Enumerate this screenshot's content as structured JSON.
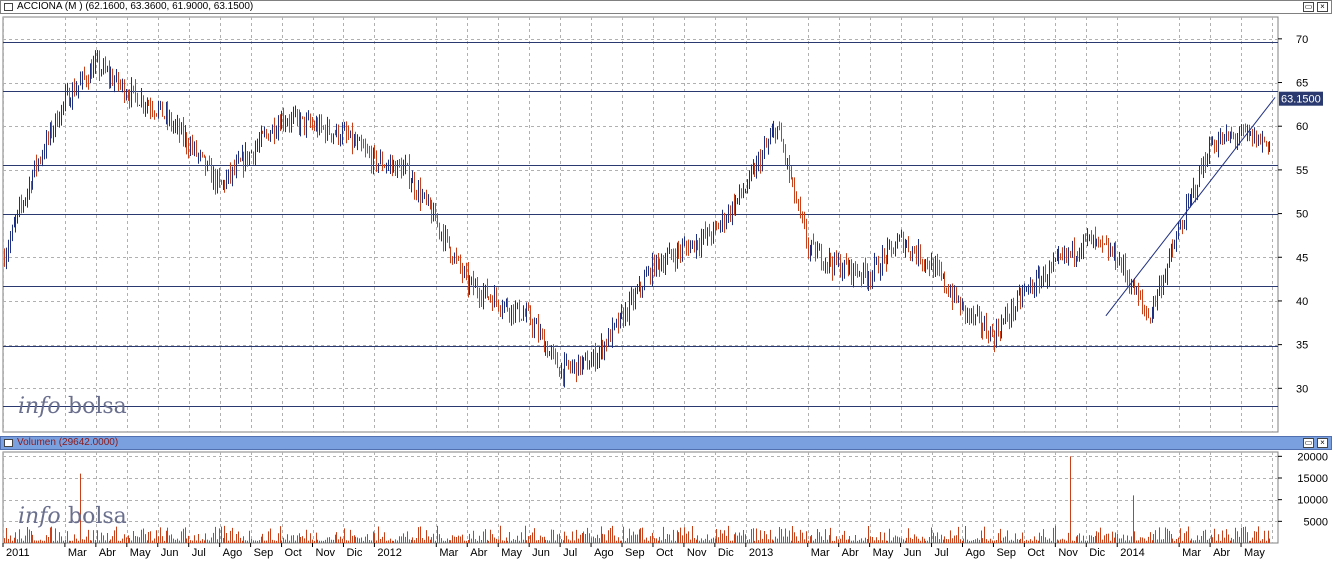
{
  "price_pane": {
    "title": "ACCIONA (M ) (62.1600, 63.3600, 61.9000, 63.1500)",
    "last_price_label": "63.1500",
    "watermark_a": "info",
    "watermark_b": "bolsa"
  },
  "volume_pane": {
    "title": "Volumen (29642.0000)",
    "watermark_a": "info",
    "watermark_b": "bolsa"
  },
  "window_buttons": {
    "restore": "▭",
    "close": "×"
  },
  "colors": {
    "up": "#1f2f80",
    "down": "#c8401a",
    "volume": "#c8401a",
    "grid": "#b0b0b0",
    "hline": "#2a3a70",
    "label_bg": "#2a3a70"
  },
  "chart_data": [
    {
      "type": "line",
      "title": "ACCIONA (M ) (62.1600, 63.3600, 61.9000, 63.1500)",
      "style": "OHLC bars",
      "x_tick_labels": [
        "2011",
        "Mar",
        "Abr",
        "May",
        "Jun",
        "Jul",
        "Ago",
        "Sep",
        "Oct",
        "Nov",
        "Dic",
        "2012",
        "Mar",
        "Abr",
        "May",
        "Jun",
        "Jul",
        "Ago",
        "Sep",
        "Oct",
        "Nov",
        "Dic",
        "2013",
        "Mar",
        "Abr",
        "May",
        "Jun",
        "Jul",
        "Ago",
        "Sep",
        "Oct",
        "Nov",
        "Dic",
        "2014",
        "Mar",
        "Abr",
        "May"
      ],
      "y_ticks": [
        30,
        35,
        40,
        45,
        50,
        55,
        60,
        65,
        70
      ],
      "ylim": [
        25,
        72.5
      ],
      "horizontal_lines": [
        69.6,
        64.0,
        55.6,
        50.0,
        41.7,
        34.8,
        28.0
      ],
      "trendline": {
        "from": [
          "2013-12-20",
          38.3
        ],
        "to": [
          "2014-06-04",
          63.3
        ]
      },
      "last_value": 63.15,
      "x": [
        "2011-01",
        "2011-02",
        "2011-03",
        "2011-04",
        "2011-05",
        "2011-06",
        "2011-07",
        "2011-08",
        "2011-09",
        "2011-10",
        "2011-11",
        "2011-12",
        "2012-01",
        "2012-02",
        "2012-03",
        "2012-04",
        "2012-05",
        "2012-06",
        "2012-07",
        "2012-08",
        "2012-09",
        "2012-10",
        "2012-11",
        "2012-12",
        "2013-01",
        "2013-02",
        "2013-03",
        "2013-04",
        "2013-05",
        "2013-06",
        "2013-07",
        "2013-08",
        "2013-09",
        "2013-10",
        "2013-11",
        "2013-12",
        "2014-01",
        "2014-02",
        "2014-03",
        "2014-04",
        "2014-05",
        "2014-06"
      ],
      "series": [
        {
          "values": [
            45,
            55,
            63,
            67,
            64,
            62,
            58,
            53,
            57,
            61,
            60,
            59,
            56,
            55,
            49,
            42,
            40,
            38,
            32,
            33,
            38,
            44,
            46,
            48,
            53,
            60,
            46,
            44,
            43,
            47,
            44,
            39,
            36,
            41,
            44,
            47,
            45,
            38,
            48,
            58,
            59,
            58
          ]
        }
      ],
      "grid": true
    },
    {
      "type": "bar",
      "title": "Volumen (29642.0000)",
      "y_ticks": [
        5000,
        10000,
        15000,
        20000
      ],
      "ylim": [
        0,
        21000
      ],
      "grid": true,
      "spikes": [
        {
          "x": "2011-03",
          "value": 16000
        },
        {
          "x": "2013-11",
          "value": 20000
        },
        {
          "x": "2014-01",
          "value": 11000
        }
      ],
      "typical_range": [
        500,
        4000
      ],
      "last_value": 29642
    }
  ]
}
